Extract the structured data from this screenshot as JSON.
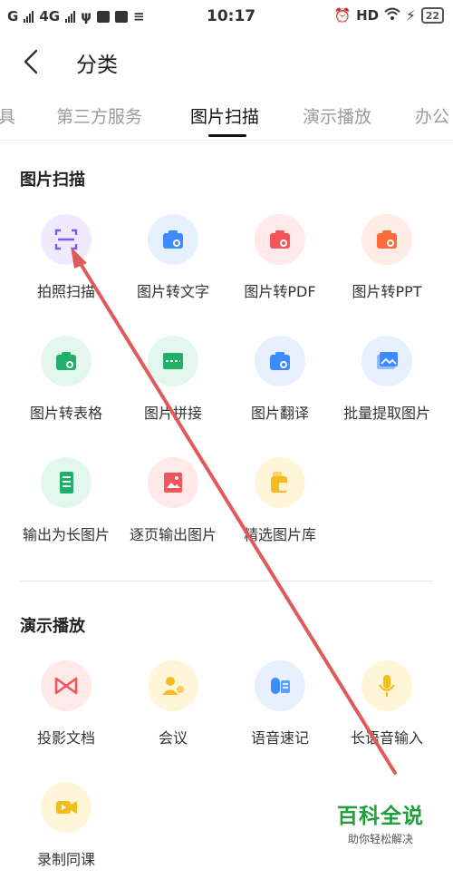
{
  "status_bar": {
    "carrier_left": "G",
    "network": "4G",
    "time": "10:17",
    "hd": "HD",
    "battery": "22"
  },
  "header": {
    "title": "分类"
  },
  "tabs": [
    {
      "label": "具"
    },
    {
      "label": "第三方服务"
    },
    {
      "label": "图片扫描"
    },
    {
      "label": "演示播放"
    },
    {
      "label": "办公"
    }
  ],
  "sections": [
    {
      "title": "图片扫描",
      "items": [
        {
          "label": "拍照扫描",
          "icon": "scan-icon",
          "bg": "#efeaff",
          "fg": "#7b5cf0"
        },
        {
          "label": "图片转文字",
          "icon": "camera-text-icon",
          "bg": "#e6f0ff",
          "fg": "#3d8bff"
        },
        {
          "label": "图片转PDF",
          "icon": "camera-pdf-icon",
          "bg": "#ffe9e9",
          "fg": "#f2555a"
        },
        {
          "label": "图片转PPT",
          "icon": "camera-ppt-icon",
          "bg": "#ffece6",
          "fg": "#ff6a3d"
        },
        {
          "label": "图片转表格",
          "icon": "camera-table-icon",
          "bg": "#e4f7ee",
          "fg": "#20b06a"
        },
        {
          "label": "图片拼接",
          "icon": "stitch-icon",
          "bg": "#e4f7ee",
          "fg": "#20b06a"
        },
        {
          "label": "图片翻译",
          "icon": "camera-translate-icon",
          "bg": "#e6f0ff",
          "fg": "#3d8bff"
        },
        {
          "label": "批量提取图片",
          "icon": "images-icon",
          "bg": "#e6f0ff",
          "fg": "#3d8bff"
        },
        {
          "label": "输出为长图片",
          "icon": "long-image-icon",
          "bg": "#e4f7ee",
          "fg": "#20b06a"
        },
        {
          "label": "逐页输出图片",
          "icon": "page-image-icon",
          "bg": "#ffe9e9",
          "fg": "#f2555a"
        },
        {
          "label": "精选图片库",
          "icon": "image-library-icon",
          "bg": "#fff6da",
          "fg": "#f5bd1c"
        }
      ]
    },
    {
      "title": "演示播放",
      "items": [
        {
          "label": "投影文档",
          "icon": "projection-icon",
          "bg": "#ffe9e9",
          "fg": "#f2555a"
        },
        {
          "label": "会议",
          "icon": "meeting-icon",
          "bg": "#fff6da",
          "fg": "#f5bd1c"
        },
        {
          "label": "语音速记",
          "icon": "voice-note-icon",
          "bg": "#e6f0ff",
          "fg": "#3d8bff"
        },
        {
          "label": "长语音输入",
          "icon": "microphone-icon",
          "bg": "#fff6da",
          "fg": "#f5bd1c"
        },
        {
          "label": "录制同课",
          "icon": "video-record-icon",
          "bg": "#fff6da",
          "fg": "#f5bd1c"
        }
      ]
    }
  ],
  "watermark": {
    "title": "百科全说",
    "subtitle": "助你轻松解决"
  },
  "annotation_arrow_color": "#e05a5a"
}
